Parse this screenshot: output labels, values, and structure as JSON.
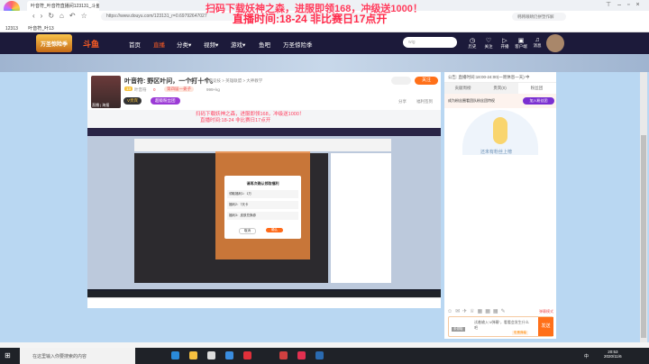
{
  "browser": {
    "logo_label": "欢迎您",
    "tab_title": "叶音符_叶音符直播间123131_斗鱼",
    "url": "https://www.douyu.com/123131_r=0.69792647027",
    "search_placeholder": "韩韩眼睛仍拼塑作解",
    "bookmarks": [
      "12313",
      "叶音符_叶13"
    ]
  },
  "overlay": {
    "line1": "扫码下载妖神之森，进服即领168，冲级送1000！",
    "line2": "直播时间:18-24 非比赛日17点开"
  },
  "nav": {
    "brand_logo": "万圣惊险季",
    "brand": "斗鱼",
    "items": [
      "首页",
      "直播",
      "分类▾",
      "视频▾",
      "游戏▾",
      "鱼吧",
      "万圣惊险季"
    ],
    "search_value": "wig",
    "icons": [
      "历史",
      "关注",
      "开播",
      "客户端",
      "消息"
    ]
  },
  "room": {
    "title": "叶音符: 野区叶问，一个打十个。",
    "report": "举报",
    "category": "网游竞技 > 英雄联盟 > 大神教学",
    "level": "13",
    "anchor": "叶音符",
    "heat": "0",
    "badge": "第四届一姜子",
    "weight": "999+kg",
    "vip_btn": "V贵宾",
    "fan_btn": "超级粉丝团",
    "follow": "关注",
    "share": "分享",
    "report_link": "福利签到",
    "avatar_caption": "直播 | 海报"
  },
  "video": {
    "dialog_title": "请再次确认领取福利",
    "dialog_items": [
      "领取福利1：1万",
      "福利2：7天卡",
      "福利3：皮肤兑换券"
    ],
    "cancel": "取消",
    "confirm": "确认"
  },
  "side": {
    "notice": "公告: 直播时间:18:00-24:00(一周休息一天) 中",
    "tabs": [
      "贡献周榜",
      "贵宾(0)",
      "粉丝团"
    ],
    "fan_text": "成为粉丝圈看团队粉丝团特权",
    "fan_button": "加入粉丝团",
    "empty": "还未有粉丝上榜",
    "chat_placeholder": "试着输入“#弹幕”，看看会发生什么吧",
    "chat_tag": "彩蛋弹幕",
    "send": "发送",
    "mode": "弹幕模式",
    "badge": "未领取"
  },
  "taskbar": {
    "search": "在这里输入你要搜索的内容",
    "time": "20:53",
    "date": "2020/11/6",
    "ime": "中"
  }
}
